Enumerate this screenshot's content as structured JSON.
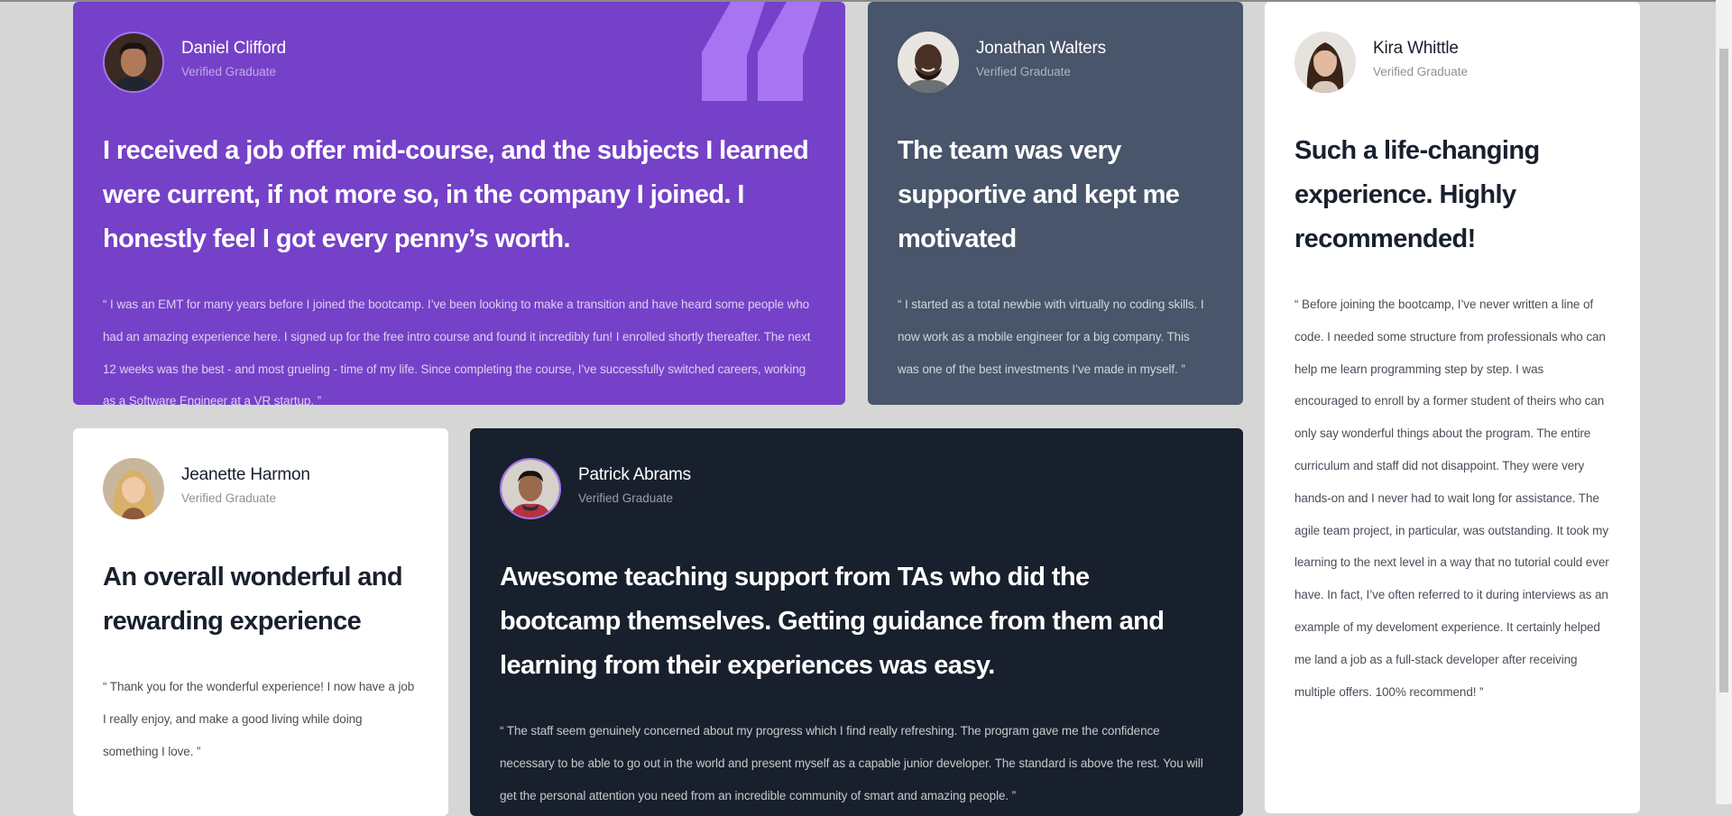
{
  "testimonials": [
    {
      "name": "Daniel Clifford",
      "role": "Verified Graduate",
      "headline": "I received a job offer mid-course, and the subjects I learned were current, if not more so, in the company I joined. I honestly feel I got every penny’s worth.",
      "body": "“ I was an EMT for many years before I joined the bootcamp. I’ve been looking to make a transition and have heard some people who had an amazing experience here. I signed up for the free intro course and found it incredibly fun! I enrolled shortly thereafter. The next 12 weeks was the best - and most grueling - time of my life. Since completing the course, I’ve successfully switched careers, working as a Software Engineer at a VR startup. ”"
    },
    {
      "name": "Jonathan Walters",
      "role": "Verified Graduate",
      "headline": "The team was very supportive and kept me motivated",
      "body": "“ I started as a total newbie with virtually no coding skills. I now work as a mobile engineer for a big company. This was one of the best investments I’ve made in myself. ”"
    },
    {
      "name": "Kira Whittle",
      "role": "Verified Graduate",
      "headline": "Such a life-changing experience. Highly recommended!",
      "body": "“ Before joining the bootcamp, I’ve never written a line of code. I needed some structure from professionals who can help me learn programming step by step. I was encouraged to enroll by a former student of theirs who can only say wonderful things about the program. The entire curriculum and staff did not disappoint. They were very hands-on and I never had to wait long for assistance. The agile team project, in particular, was outstanding. It took my learning to the next level in a way that no tutorial could ever have. In fact, I’ve often referred to it during interviews as an example of my develoment experience. It certainly helped me land a job as a full-stack developer after receiving multiple offers. 100% recommend! ”"
    },
    {
      "name": "Jeanette Harmon",
      "role": "Verified Graduate",
      "headline": "An overall wonderful and rewarding experience",
      "body": "“ Thank you for the wonderful experience! I now have a job I really enjoy, and make a good living while doing something I love. ”"
    },
    {
      "name": "Patrick Abrams",
      "role": "Verified Graduate",
      "headline": "Awesome teaching support from TAs who did the bootcamp themselves. Getting guidance from them and learning from their experiences was easy.",
      "body": "“ The staff seem genuinely concerned about my progress which I find really refreshing. The program gave me the confidence necessary to be able to go out in the world and present myself as a capable junior developer. The standard is above the rest. You will get the personal attention you need from an incredible community of smart and amazing people. ”"
    }
  ],
  "colors": {
    "purple": "#7541c8",
    "slate": "#48556a",
    "dark": "#19202d",
    "white": "#ffffff",
    "background": "#d6d6d6",
    "accent_violet": "#a775f1"
  },
  "icons": {
    "quote": "quotation-mark-icon"
  }
}
